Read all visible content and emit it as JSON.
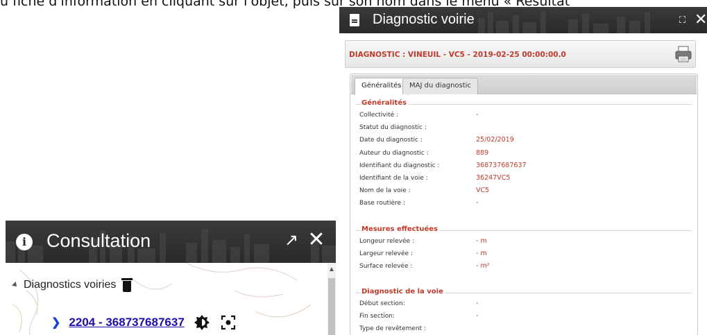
{
  "top_text": "u fiche d'information en cliquant sur l'objet, puis sur son nom dans le menu « Résultat",
  "consultation": {
    "title": "Consultation",
    "tree_root_label": "Diagnostics voiries",
    "diagnostic_link": "2204 - 368737687637",
    "icons": [
      "info-icon",
      "expand-icon",
      "close-icon",
      "trash-icon",
      "chevron-right-icon",
      "contrast-icon",
      "focus-icon"
    ]
  },
  "diagnostic_window": {
    "title": "Diagnostic voirie",
    "bar_title": "DIAGNOSTIC : VINEUIL - VC5 - 2019-02-25 00:00:00.0",
    "tabs": [
      {
        "label": "Généralités",
        "active": true
      },
      {
        "label": "MAJ du diagnostic",
        "active": false
      }
    ],
    "sections": [
      {
        "title": "Généralités",
        "rows": [
          {
            "key": "Collectivité :",
            "value": "-"
          },
          {
            "key": "Statut du diagnostic :",
            "value": ""
          },
          {
            "key": "Date du diagnostic :",
            "value": "25/02/2019"
          },
          {
            "key": "Auteur du diagnostic :",
            "value": "889"
          },
          {
            "key": "Identifiant du diagnostic :",
            "value": "368737687637"
          },
          {
            "key": "Identifiant de la voie :",
            "value": "36247VC5"
          },
          {
            "key": "Nom de la voie :",
            "value": "VC5"
          },
          {
            "key": "Base routière :",
            "value": "-"
          }
        ]
      },
      {
        "title": "Mesures effectuées",
        "rows": [
          {
            "key": "Longeur relevée :",
            "value": "- m"
          },
          {
            "key": "Largeur relevée :",
            "value": "- m"
          },
          {
            "key": "Surface relevée :",
            "value": "- m²"
          }
        ]
      },
      {
        "title": "Diagnostic de la voie",
        "rows": [
          {
            "key": "Début section:",
            "value": "-"
          },
          {
            "key": "Fin section:",
            "value": "-"
          },
          {
            "key": "Type de revêtement :",
            "value": ""
          }
        ]
      }
    ]
  },
  "colors": {
    "accent_red": "#c0392b",
    "header_dark": "#2d2d2d",
    "link_blue": "#1a0dab"
  }
}
